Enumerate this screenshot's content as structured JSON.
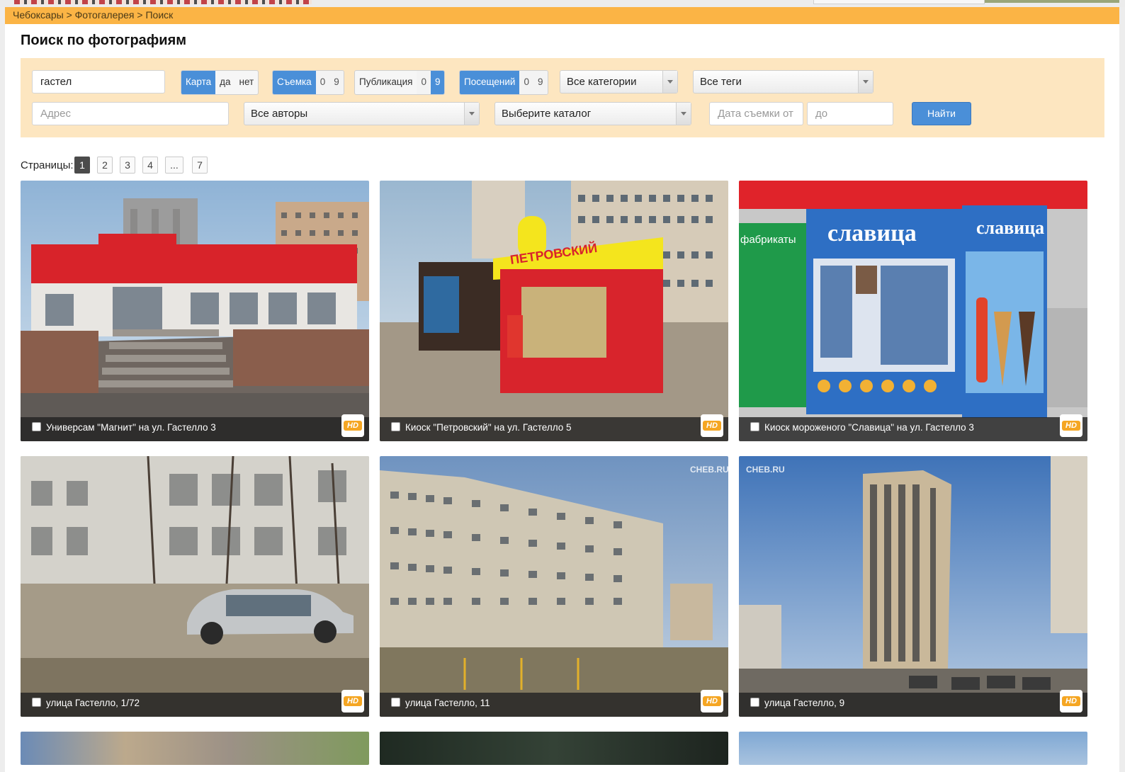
{
  "breadcrumbs": [
    "Чебоксары",
    "Фотогалерея",
    "Поиск"
  ],
  "breadcrumb_separator": ">",
  "page_title": "Поиск по фотографиям",
  "filters": {
    "search_value": "гастел",
    "map_toggle": {
      "label": "Карта",
      "yes": "да",
      "no": "нет"
    },
    "shooting_toggle": {
      "label": "Съемка",
      "from": "0",
      "to": "9"
    },
    "publication_toggle": {
      "label": "Публикация",
      "from": "0",
      "to": "9"
    },
    "visits_toggle": {
      "label": "Посещений",
      "from": "0",
      "to": "9"
    },
    "categories_select": "Все категории",
    "tags_select": "Все теги",
    "address_placeholder": "Адрес",
    "authors_select": "Все авторы",
    "catalog_select": "Выберите каталог",
    "date_from_placeholder": "Дата съемки от",
    "date_to_placeholder": "до",
    "find_button": "Найти"
  },
  "pagination": {
    "label": "Страницы:",
    "pages": [
      "1",
      "2",
      "3",
      "4",
      "...",
      "7"
    ],
    "current": "1"
  },
  "photos": [
    {
      "caption": "Универсам \"Магнит\" на ул. Гастелло 3",
      "badge": "HD"
    },
    {
      "caption": "Киоск \"Петровский\" на ул. Гастелло 5",
      "badge": "HD",
      "sign_text": "ПЕТРОВСКИЙ"
    },
    {
      "caption": "Киоск мороженого \"Славица\" на ул. Гастелло 3",
      "badge": "HD",
      "sign_text": "славица",
      "sign_text2": "фабрикаты"
    },
    {
      "caption": "улица Гастелло, 1/72",
      "badge": "HD"
    },
    {
      "caption": "улица Гастелло, 11",
      "badge": "HD",
      "watermark": "CHEB.RU"
    },
    {
      "caption": "улица Гастелло, 9",
      "badge": "HD",
      "watermark": "CHEB.RU"
    }
  ],
  "colors": {
    "accent_blue": "#4a8fd8",
    "breadcrumb_bar": "#fbb445",
    "filter_panel": "#fde6c0",
    "hd_badge": "#f5a623"
  }
}
